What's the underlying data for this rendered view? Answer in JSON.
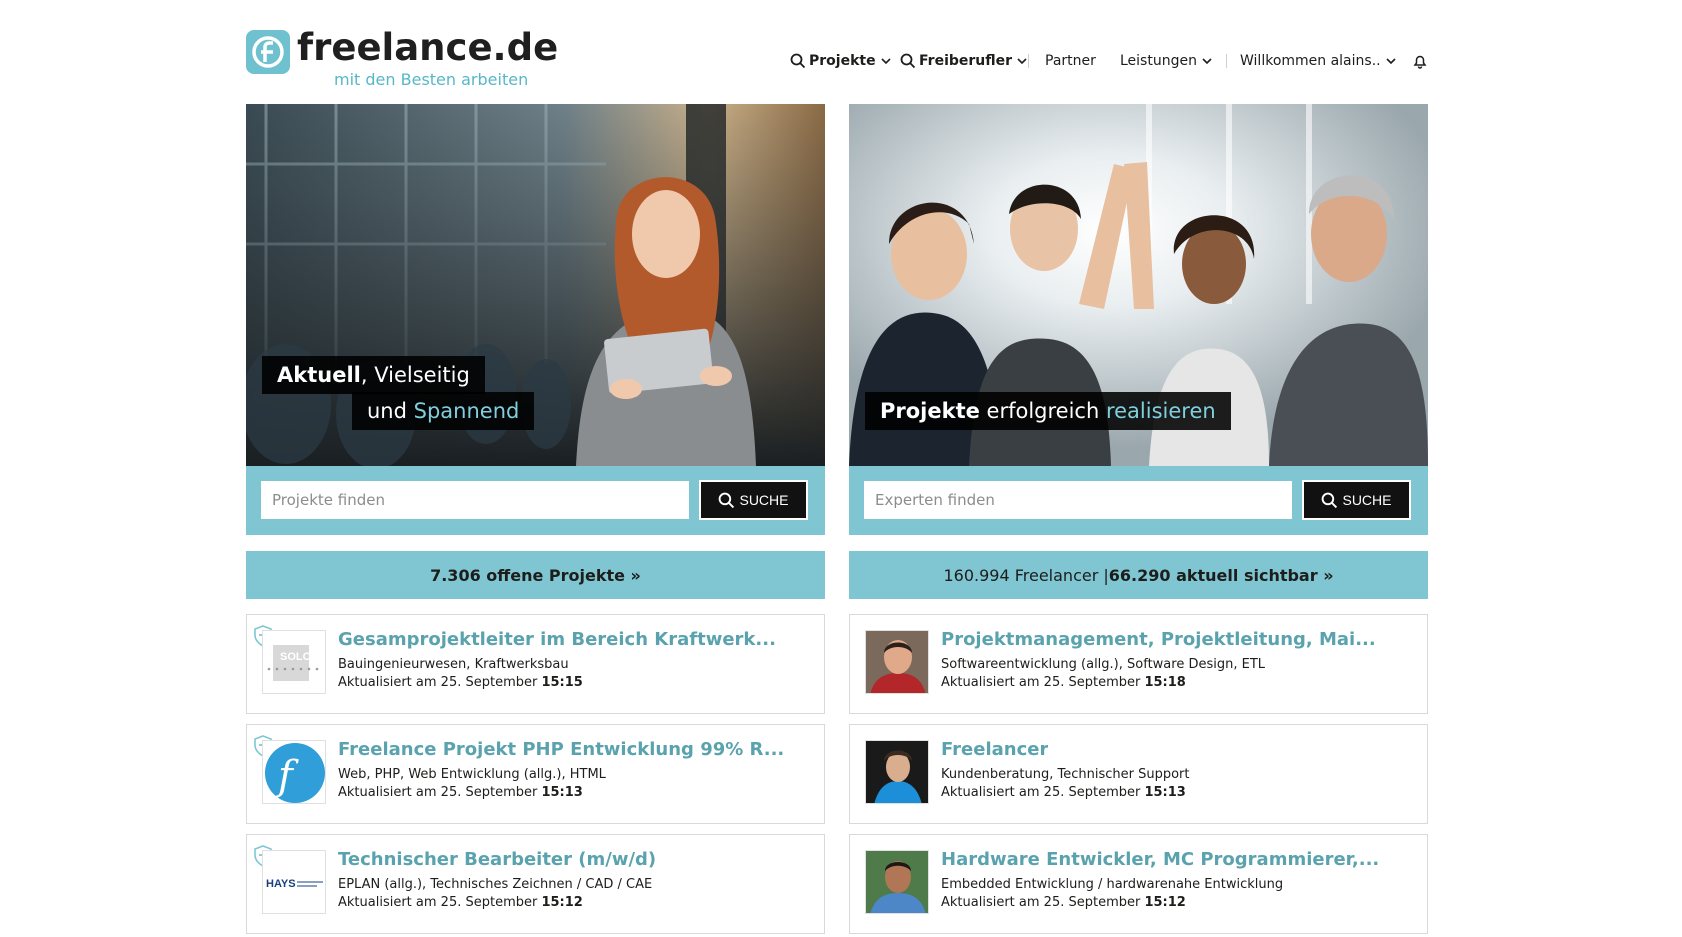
{
  "header": {
    "logo_name": "freelance.de",
    "logo_tagline": "mit den Besten arbeiten",
    "nav": {
      "projekte": "Projekte",
      "freiberufler": "Freiberufler",
      "partner": "Partner",
      "leistungen": "Leistungen",
      "user": "Willkommen alains.."
    }
  },
  "left_hero": {
    "caption_line1_bold": "Aktuell",
    "caption_line1_rest": ", Vielseitig",
    "caption_line2_plain": "und ",
    "caption_line2_accent": "Spannend",
    "search_placeholder": "Projekte finden",
    "search_button": "SUCHE"
  },
  "right_hero": {
    "caption_bold": "Projekte",
    "caption_plain": " erfolgreich ",
    "caption_accent": "realisieren",
    "search_placeholder": "Experten finden",
    "search_button": "SUCHE"
  },
  "counts": {
    "projects": "7.306 offene Projekte »",
    "freelancers_plain": "160.994 Freelancer | ",
    "freelancers_bold": "66.290 aktuell sichtbar »"
  },
  "projects": [
    {
      "title": "Gesamprojektleiter im Bereich Kraftwerk...",
      "tags": "Bauingenieurwesen, Kraftwerksbau",
      "updated_prefix": "Aktualisiert am 25. September ",
      "updated_time": "15:15",
      "logo": "SOLCOM"
    },
    {
      "title": "Freelance Projekt PHP Entwicklung 99% R...",
      "tags": "Web, PHP, Web Entwicklung (allg.), HTML",
      "updated_prefix": "Aktualisiert am 25. September ",
      "updated_time": "15:13",
      "logo": "f"
    },
    {
      "title": "Technischer Bearbeiter (m/w/d)",
      "tags": "EPLAN (allg.), Technisches Zeichnen / CAD / CAE",
      "updated_prefix": "Aktualisiert am 25. September ",
      "updated_time": "15:12",
      "logo": "HAYS"
    }
  ],
  "freelancers": [
    {
      "title": "Projektmanagement, Projektleitung, Mai...",
      "tags": "Softwareentwicklung (allg.), Software Design, ETL",
      "updated_prefix": "Aktualisiert am 25. September ",
      "updated_time": "15:18"
    },
    {
      "title": "Freelancer",
      "tags": "Kundenberatung, Technischer Support",
      "updated_prefix": "Aktualisiert am 25. September ",
      "updated_time": "15:13"
    },
    {
      "title": "Hardware Entwickler, MC Programmierer,...",
      "tags": "Embedded Entwicklung / hardwarenahe Entwicklung",
      "updated_prefix": "Aktualisiert am 25. September ",
      "updated_time": "15:12"
    }
  ],
  "colors": {
    "accent": "#7fc6d2",
    "title_teal": "#5aa3ae",
    "caption_bg": "#111111"
  }
}
